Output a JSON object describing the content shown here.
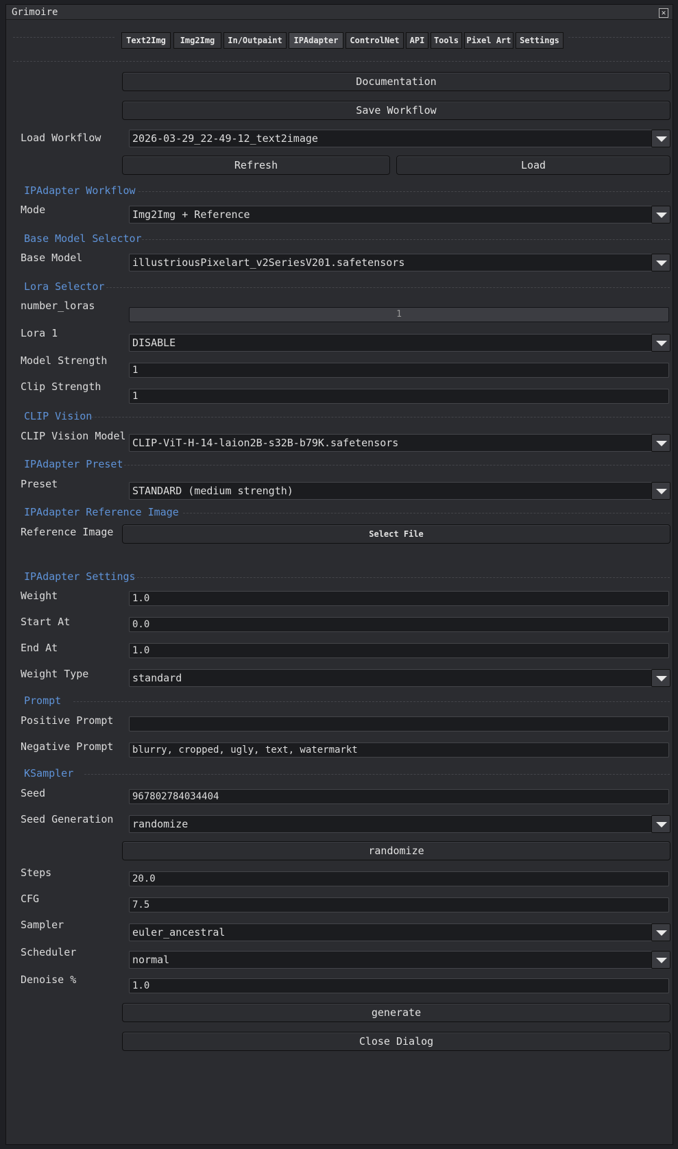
{
  "window": {
    "title": "Grimoire"
  },
  "tabs": [
    "Text2Img",
    "Img2Img",
    "In/Outpaint",
    "IPAdapter",
    "ControlNet",
    "API",
    "Tools",
    "Pixel Art",
    "Settings"
  ],
  "buttons": {
    "documentation": "Documentation",
    "save_workflow": "Save Workflow",
    "refresh": "Refresh",
    "load": "Load",
    "select_file": "Select File",
    "randomize": "randomize",
    "generate": "generate",
    "close_dialog": "Close Dialog"
  },
  "load_workflow": {
    "label": "Load Workflow",
    "value": "2026-03-29_22-49-12_text2image"
  },
  "sections": {
    "ipadapter_workflow": "IPAdapter Workflow",
    "base_model_selector": "Base Model Selector",
    "lora_selector": "Lora Selector",
    "clip_vision": "CLIP Vision",
    "ipadapter_preset": "IPAdapter Preset",
    "ipadapter_reference_image": "IPAdapter Reference Image",
    "ipadapter_settings": "IPAdapter Settings",
    "prompt": "Prompt",
    "ksampler": "KSampler"
  },
  "mode": {
    "label": "Mode",
    "value": "Img2Img + Reference"
  },
  "base_model": {
    "label": "Base Model",
    "value": "illustriousPixelart_v2SeriesV201.safetensors"
  },
  "number_loras": {
    "label": "number_loras",
    "value": "1"
  },
  "lora1": {
    "label": "Lora 1",
    "value": "DISABLE"
  },
  "model_strength": {
    "label": "Model Strength",
    "value": "1"
  },
  "clip_strength": {
    "label": "Clip Strength",
    "value": "1"
  },
  "clip_vision_model": {
    "label": "CLIP Vision Model",
    "value": "CLIP-ViT-H-14-laion2B-s32B-b79K.safetensors"
  },
  "preset": {
    "label": "Preset",
    "value": "STANDARD (medium strength)"
  },
  "reference_image": {
    "label": "Reference Image"
  },
  "weight": {
    "label": "Weight",
    "value": "1.0"
  },
  "start_at": {
    "label": "Start At",
    "value": "0.0"
  },
  "end_at": {
    "label": "End At",
    "value": "1.0"
  },
  "weight_type": {
    "label": "Weight Type",
    "value": "standard"
  },
  "positive_prompt": {
    "label": "Positive Prompt",
    "value": ""
  },
  "negative_prompt": {
    "label": "Negative Prompt",
    "value": "blurry, cropped, ugly, text, watermarkt"
  },
  "seed": {
    "label": "Seed",
    "value": "967802784034404"
  },
  "seed_generation": {
    "label": "Seed Generation",
    "value": "randomize"
  },
  "steps": {
    "label": "Steps",
    "value": "20.0"
  },
  "cfg": {
    "label": "CFG",
    "value": "7.5"
  },
  "sampler": {
    "label": "Sampler",
    "value": "euler_ancestral"
  },
  "scheduler": {
    "label": "Scheduler",
    "value": "normal"
  },
  "denoise": {
    "label": "Denoise %",
    "value": "1.0"
  }
}
